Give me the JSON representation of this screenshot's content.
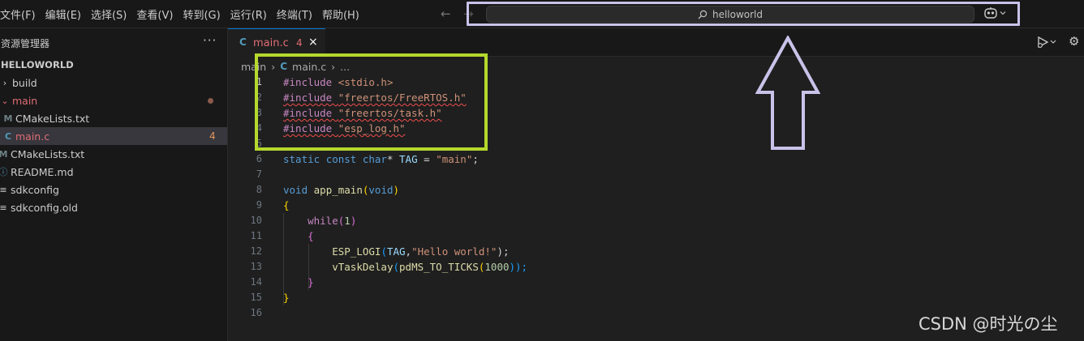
{
  "menu": [
    "文件(F)",
    "编辑(E)",
    "选择(S)",
    "查看(V)",
    "转到(G)",
    "运行(R)",
    "终端(T)",
    "帮助(H)"
  ],
  "search": {
    "text": "helloworld",
    "icon": "search-icon"
  },
  "copilot": {
    "icon": "copilot-icon"
  },
  "sidebar": {
    "title": "资源管理器",
    "more": "···",
    "root": "HELLOWORLD",
    "items": [
      {
        "label": "build",
        "type": "folder",
        "state": "collapsed"
      },
      {
        "label": "main",
        "type": "folder",
        "state": "expanded",
        "modified": true
      },
      {
        "label": "CMakeLists.txt",
        "type": "cmake",
        "indent": 1
      },
      {
        "label": "main.c",
        "type": "c",
        "indent": 1,
        "badge": "4",
        "selected": true
      },
      {
        "label": "CMakeLists.txt",
        "type": "cmake"
      },
      {
        "label": "README.md",
        "type": "info"
      },
      {
        "label": "sdkconfig",
        "type": "file"
      },
      {
        "label": "sdkconfig.old",
        "type": "file"
      }
    ]
  },
  "tab": {
    "icon_letter": "C",
    "label": "main.c",
    "badge": "4",
    "close": "×"
  },
  "breadcrumb": {
    "folder": "main",
    "icon_letter": "C",
    "file": "main.c",
    "more": "..."
  },
  "code": {
    "line_numbers": [
      "1",
      "2",
      "3",
      "4",
      "5",
      "6",
      "7",
      "8",
      "9",
      "10",
      "11",
      "12",
      "13",
      "14",
      "15",
      "16"
    ],
    "l1": [
      "#include ",
      "<stdio.h>"
    ],
    "l2": [
      "#include ",
      "\"freertos/FreeRTOS.h\""
    ],
    "l3": [
      "#include ",
      "\"freertos/task.h\""
    ],
    "l4": [
      "#include ",
      "\"esp_log.h\""
    ],
    "l6": [
      "static",
      " ",
      "const",
      " ",
      "char",
      "* ",
      "TAG",
      " = ",
      "\"main\"",
      ";"
    ],
    "l8": [
      "void",
      " ",
      "app_main",
      "(",
      "void",
      ")"
    ],
    "l9": [
      "{"
    ],
    "l10": [
      "while",
      "(",
      "1",
      ")"
    ],
    "l11": [
      "{"
    ],
    "l12": [
      "ESP_LOGI",
      "(",
      "TAG",
      ",",
      "\"Hello world!\"",
      ");"
    ],
    "l13": [
      "vTaskDelay",
      "(",
      "pdMS_TO_TICKS",
      "(",
      "1000",
      "));"
    ],
    "l14": [
      "}"
    ],
    "l15": [
      "}"
    ]
  },
  "watermark": "CSDN @时光の尘",
  "colors": {
    "highlight_box": "#b5d82c",
    "arrow": "#c9c3ea",
    "error": "#e06c75",
    "accent": "#0078d4"
  }
}
